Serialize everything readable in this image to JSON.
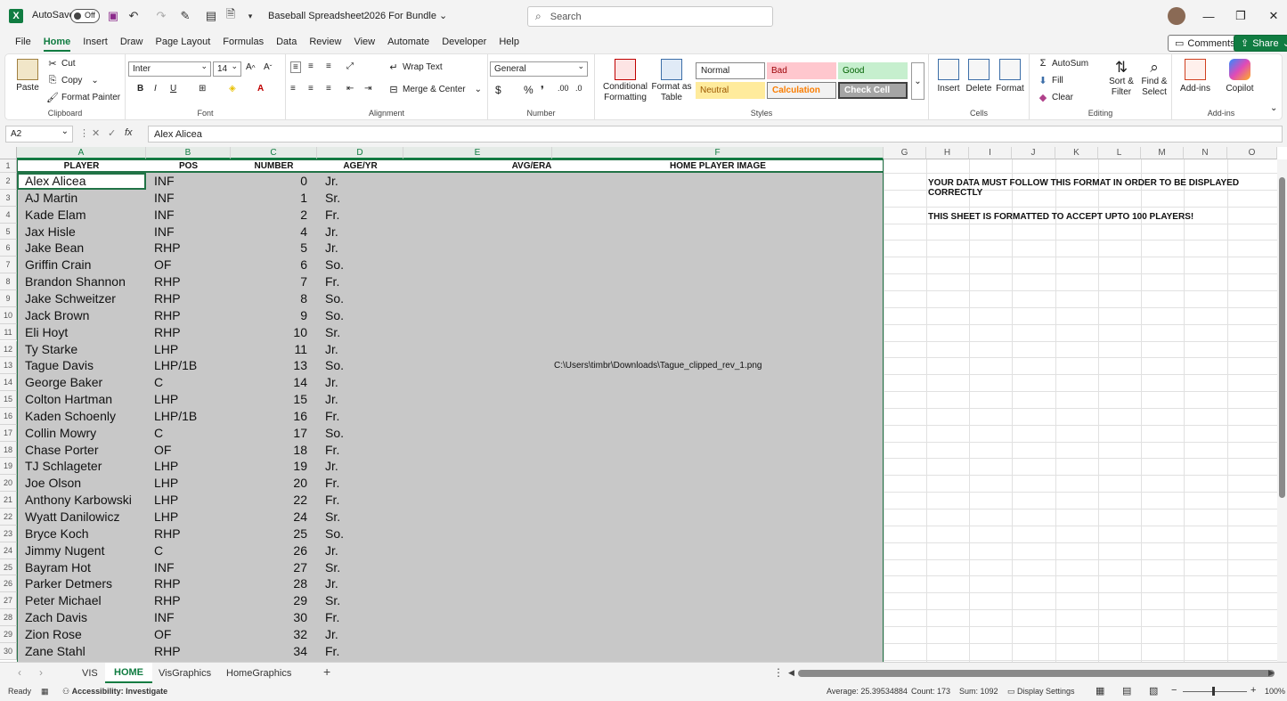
{
  "titlebar": {
    "autosave_label": "AutoSave",
    "toggle_state": "Off",
    "document_title": "Baseball Spreadsheet2026 For Bundle",
    "search_placeholder": "Search"
  },
  "menu": [
    "File",
    "Home",
    "Insert",
    "Draw",
    "Page Layout",
    "Formulas",
    "Data",
    "Review",
    "View",
    "Automate",
    "Developer",
    "Help"
  ],
  "menu_active": "Home",
  "comments_label": "Comments",
  "share_label": "Share",
  "ribbon": {
    "clipboard": {
      "label": "Clipboard",
      "paste": "Paste",
      "cut": "Cut",
      "copy": "Copy",
      "format_painter": "Format Painter"
    },
    "font": {
      "label": "Font",
      "font_name": "Inter",
      "font_size": "14"
    },
    "alignment": {
      "label": "Alignment",
      "wrap_text": "Wrap Text",
      "merge_center": "Merge & Center"
    },
    "number": {
      "label": "Number",
      "format": "General"
    },
    "styles": {
      "label": "Styles",
      "conditional_formatting": "Conditional Formatting",
      "format_as_table": "Format as Table",
      "normal": "Normal",
      "bad": "Bad",
      "good": "Good",
      "neutral": "Neutral",
      "calculation": "Calculation",
      "check_cell": "Check Cell"
    },
    "cells": {
      "label": "Cells",
      "insert": "Insert",
      "delete": "Delete",
      "format": "Format"
    },
    "editing": {
      "label": "Editing",
      "autosum": "AutoSum",
      "fill": "Fill",
      "clear": "Clear",
      "sort_filter": "Sort & Filter",
      "find_select": "Find & Select"
    },
    "addins": {
      "label": "Add-ins",
      "addins_btn": "Add-ins",
      "copilot": "Copilot"
    }
  },
  "formula_bar": {
    "name_box": "A2",
    "fx": "fx",
    "content": "Alex Alicea"
  },
  "columns": [
    "A",
    "B",
    "C",
    "D",
    "E",
    "F",
    "G",
    "H",
    "I",
    "J",
    "K",
    "L",
    "M",
    "N",
    "O"
  ],
  "header_row": {
    "player": "PLAYER",
    "pos": "POS",
    "number": "NUMBER",
    "age": "AGE/YR",
    "avg": "AVG/ERA",
    "image": "HOME PLAYER IMAGE"
  },
  "rows": [
    {
      "n": "2",
      "player": "Alex Alicea",
      "pos": "INF",
      "num": "0",
      "yr": "Jr."
    },
    {
      "n": "3",
      "player": "AJ Martin",
      "pos": "INF",
      "num": "1",
      "yr": "Sr."
    },
    {
      "n": "4",
      "player": "Kade Elam",
      "pos": "INF",
      "num": "2",
      "yr": "Fr."
    },
    {
      "n": "5",
      "player": "Jax Hisle",
      "pos": "INF",
      "num": "4",
      "yr": "Jr."
    },
    {
      "n": "6",
      "player": "Jake Bean",
      "pos": "RHP",
      "num": "5",
      "yr": "Jr."
    },
    {
      "n": "7",
      "player": "Griffin Crain",
      "pos": "OF",
      "num": "6",
      "yr": "So."
    },
    {
      "n": "8",
      "player": "Brandon Shannon",
      "pos": "RHP",
      "num": "7",
      "yr": "Fr."
    },
    {
      "n": "9",
      "player": "Jake Schweitzer",
      "pos": "RHP",
      "num": "8",
      "yr": "So."
    },
    {
      "n": "10",
      "player": "Jack Brown",
      "pos": "RHP",
      "num": "9",
      "yr": "So."
    },
    {
      "n": "11",
      "player": "Eli Hoyt",
      "pos": "RHP",
      "num": "10",
      "yr": "Sr."
    },
    {
      "n": "12",
      "player": "Ty Starke",
      "pos": "LHP",
      "num": "11",
      "yr": "Jr."
    },
    {
      "n": "13",
      "player": "Tague Davis",
      "pos": "LHP/1B",
      "num": "13",
      "yr": "So.",
      "image": "C:\\Users\\timbr\\Downloads\\Tague_clipped_rev_1.png"
    },
    {
      "n": "14",
      "player": "George Baker",
      "pos": "C",
      "num": "14",
      "yr": "Jr."
    },
    {
      "n": "15",
      "player": "Colton Hartman",
      "pos": "LHP",
      "num": "15",
      "yr": "Jr."
    },
    {
      "n": "16",
      "player": "Kaden Schoenly",
      "pos": "LHP/1B",
      "num": "16",
      "yr": "Fr."
    },
    {
      "n": "17",
      "player": "Collin Mowry",
      "pos": "C",
      "num": "17",
      "yr": "So."
    },
    {
      "n": "18",
      "player": "Chase Porter",
      "pos": "OF",
      "num": "18",
      "yr": "Fr."
    },
    {
      "n": "19",
      "player": "TJ Schlageter",
      "pos": "LHP",
      "num": "19",
      "yr": "Jr."
    },
    {
      "n": "20",
      "player": "Joe Olson",
      "pos": "LHP",
      "num": "20",
      "yr": "Fr."
    },
    {
      "n": "21",
      "player": "Anthony Karbowski",
      "pos": "LHP",
      "num": "22",
      "yr": "Fr."
    },
    {
      "n": "22",
      "player": "Wyatt Danilowicz",
      "pos": "LHP",
      "num": "24",
      "yr": "Sr."
    },
    {
      "n": "23",
      "player": "Bryce Koch",
      "pos": "RHP",
      "num": "25",
      "yr": "So."
    },
    {
      "n": "24",
      "player": "Jimmy Nugent",
      "pos": "C",
      "num": "26",
      "yr": "Jr."
    },
    {
      "n": "25",
      "player": "Bayram Hot",
      "pos": "INF",
      "num": "27",
      "yr": "Sr."
    },
    {
      "n": "26",
      "player": "Parker Detmers",
      "pos": "RHP",
      "num": "28",
      "yr": "Jr."
    },
    {
      "n": "27",
      "player": "Peter Michael",
      "pos": "RHP",
      "num": "29",
      "yr": "Sr."
    },
    {
      "n": "28",
      "player": "Zach Davis",
      "pos": "INF",
      "num": "30",
      "yr": "Fr."
    },
    {
      "n": "29",
      "player": "Zion Rose",
      "pos": "OF",
      "num": "32",
      "yr": "Jr."
    },
    {
      "n": "30",
      "player": "Zane Stahl",
      "pos": "RHP",
      "num": "34",
      "yr": "Fr."
    }
  ],
  "notes": {
    "format_note": "YOUR DATA MUST FOLLOW THIS FORMAT IN ORDER TO BE DISPLAYED CORRECTLY",
    "capacity_note": "THIS SHEET IS FORMATTED TO ACCEPT UPTO 100 PLAYERS!"
  },
  "sheet_tabs": [
    "VIS",
    "HOME",
    "VisGraphics",
    "HomeGraphics"
  ],
  "active_sheet": "HOME",
  "status": {
    "ready": "Ready",
    "accessibility": "Accessibility: Investigate",
    "average": "Average: 25.39534884",
    "count": "Count: 173",
    "sum": "Sum: 1092",
    "display_settings": "Display Settings",
    "zoom": "100%"
  },
  "colors": {
    "accent": "#107c41",
    "selection_border": "#217346",
    "shade": "#c8c8c8"
  }
}
